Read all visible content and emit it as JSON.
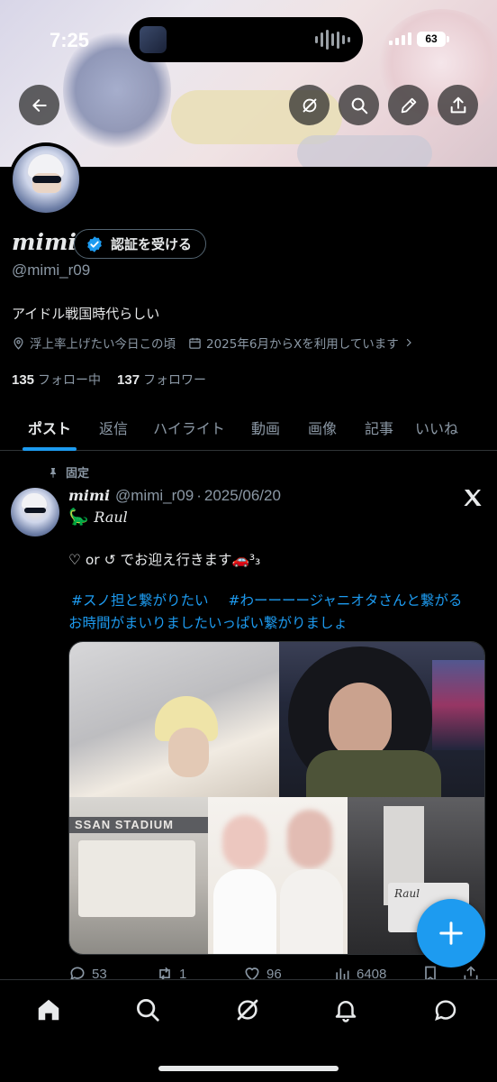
{
  "status_bar": {
    "time": "7:25",
    "battery": "63"
  },
  "header": {
    "buttons": [
      "back",
      "grok",
      "search",
      "edit",
      "share"
    ]
  },
  "profile": {
    "display_name": "mimi",
    "verify_button_label": "認証を受ける",
    "handle": "@mimi_r09",
    "bio": "アイドル戦国時代らしい",
    "location": "浮上率上げたい今日この頃",
    "joined": "2025年6月からXを利用しています",
    "following_count": "135",
    "following_label": "フォロー中",
    "followers_count": "137",
    "followers_label": "フォロワー"
  },
  "tabs": [
    {
      "label": "ポスト",
      "active": true
    },
    {
      "label": "返信",
      "active": false
    },
    {
      "label": "ハイライト",
      "active": false
    },
    {
      "label": "動画",
      "active": false
    },
    {
      "label": "画像",
      "active": false
    },
    {
      "label": "記事",
      "active": false
    },
    {
      "label": "いいね",
      "active": false
    }
  ],
  "pinned_post": {
    "pinned_label": "固定",
    "author_name": "mimi",
    "author_handle": "@mimi_r09",
    "separator": "·",
    "date": "2025/06/20",
    "line1_emoji": "🦕",
    "line1_text": "Raul",
    "line2_text": "♡ or ↺ でお迎え行きます🚗³₃",
    "hashtag1": "#スノ担と繋がりたい",
    "hashtag2": "#わーーーージャニオタさんと繋がる",
    "hashtag_line2": "お時間がまいりましたいっぱい繋がりましょ",
    "photo_sign_text": "SSAN STADIUM",
    "photo_card_text": "Raul",
    "reply_count": "53",
    "repost_count": "1",
    "like_count": "96",
    "view_count": "6408"
  },
  "bottom_nav": [
    "home",
    "search",
    "grok",
    "notifications",
    "messages"
  ],
  "colors": {
    "accent": "#1d9bf0",
    "background": "#000000",
    "text": "#e7e9ea",
    "muted": "#8b98a5",
    "border": "#2f3336"
  }
}
